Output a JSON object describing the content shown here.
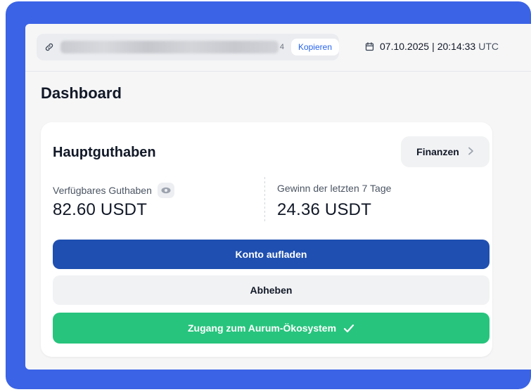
{
  "topbar": {
    "copy_label": "Kopieren",
    "url_visible_suffix": "4",
    "date": "07.10.2025",
    "time": "20:14:33",
    "timezone": "UTC",
    "separator": "|"
  },
  "page": {
    "title": "Dashboard"
  },
  "card": {
    "title": "Hauptguthaben",
    "finance_button": "Finanzen",
    "available_label": "Verfügbares Guthaben",
    "available_value": "82.60 USDT",
    "profit_label": "Gewinn der letzten 7 Tage",
    "profit_value": "24.36 USDT",
    "topup_button": "Konto aufladen",
    "withdraw_button": "Abheben",
    "ecosystem_button": "Zugang zum Aurum-Ökosystem"
  },
  "colors": {
    "frame": "#3b63e6",
    "primary_button": "#1f4fb0",
    "green_button": "#27c47d",
    "link": "#2563eb"
  },
  "icons": {
    "link": "link-icon",
    "calendar": "calendar-icon",
    "eye": "eye-icon",
    "chevron": "chevron-right-icon",
    "check": "check-icon"
  }
}
